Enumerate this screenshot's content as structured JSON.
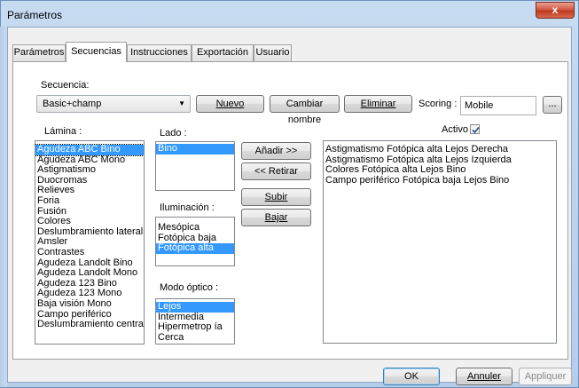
{
  "window": {
    "title": "Parámetros",
    "close_glyph": "x"
  },
  "tabs": [
    {
      "label": "Parámetros"
    },
    {
      "label": "Secuencias",
      "active": true
    },
    {
      "label": "Instrucciones"
    },
    {
      "label": "Exportación"
    },
    {
      "label": "Usuario"
    }
  ],
  "secuencia": {
    "label": "Secuencia:",
    "selected": "Basic+champ"
  },
  "buttons": {
    "nuevo": "Nuevo",
    "cambiar": "Cambiar nombre",
    "eliminar": "Eliminar",
    "dots": "...",
    "anadir": "Añadir >>",
    "retirar": "<< Retirar",
    "subir": "Subir",
    "bajar": "Bajar"
  },
  "scoring": {
    "label": "Scoring :",
    "value": "Mobile"
  },
  "activo": {
    "label": "Activo",
    "checked": true
  },
  "lamina": {
    "label": "Lámina :",
    "items": [
      {
        "text": "Agudeza ABC Bino",
        "selected": true
      },
      {
        "text": "Agudeza ABC Mono"
      },
      {
        "text": "Astigmatismo"
      },
      {
        "text": "Duocromas"
      },
      {
        "text": "Relieves"
      },
      {
        "text": "Foria"
      },
      {
        "text": "Fusión"
      },
      {
        "text": "Colores"
      },
      {
        "text": "Deslumbramiento lateral"
      },
      {
        "text": "Amsler"
      },
      {
        "text": "Contrastes"
      },
      {
        "text": "Agudeza Landolt Bino"
      },
      {
        "text": "Agudeza Landolt Mono"
      },
      {
        "text": "Agudeza 123 Bino"
      },
      {
        "text": "Agudeza 123 Mono"
      },
      {
        "text": "Baja visión Mono"
      },
      {
        "text": "Campo periférico"
      },
      {
        "text": "Deslumbramiento central"
      }
    ]
  },
  "lado": {
    "label": "Lado :",
    "items": [
      {
        "text": "Bino",
        "selected": true
      }
    ]
  },
  "iluminacion": {
    "label": "Iluminación :",
    "items": [
      {
        "text": "Mesópica"
      },
      {
        "text": "Fotópica baja"
      },
      {
        "text": "Fotópica alta",
        "selected": true
      }
    ]
  },
  "modo": {
    "label": "Modo óptico :",
    "items": [
      {
        "text": "Lejos",
        "selected": true
      },
      {
        "text": "Intermedia"
      },
      {
        "text": "Hipermetrop ía"
      },
      {
        "text": "Cerca"
      }
    ]
  },
  "secuencia_items": [
    "Astigmatismo  Fotópica alta  Lejos  Derecha",
    "Astigmatismo  Fotópica alta  Lejos  Izquierda",
    "Colores  Fotópica alta  Lejos  Bino",
    "Campo periférico  Fotópica baja  Lejos  Bino"
  ],
  "footer": {
    "ok": "OK",
    "cancel": "Annuler",
    "apply": "Appliquer"
  }
}
